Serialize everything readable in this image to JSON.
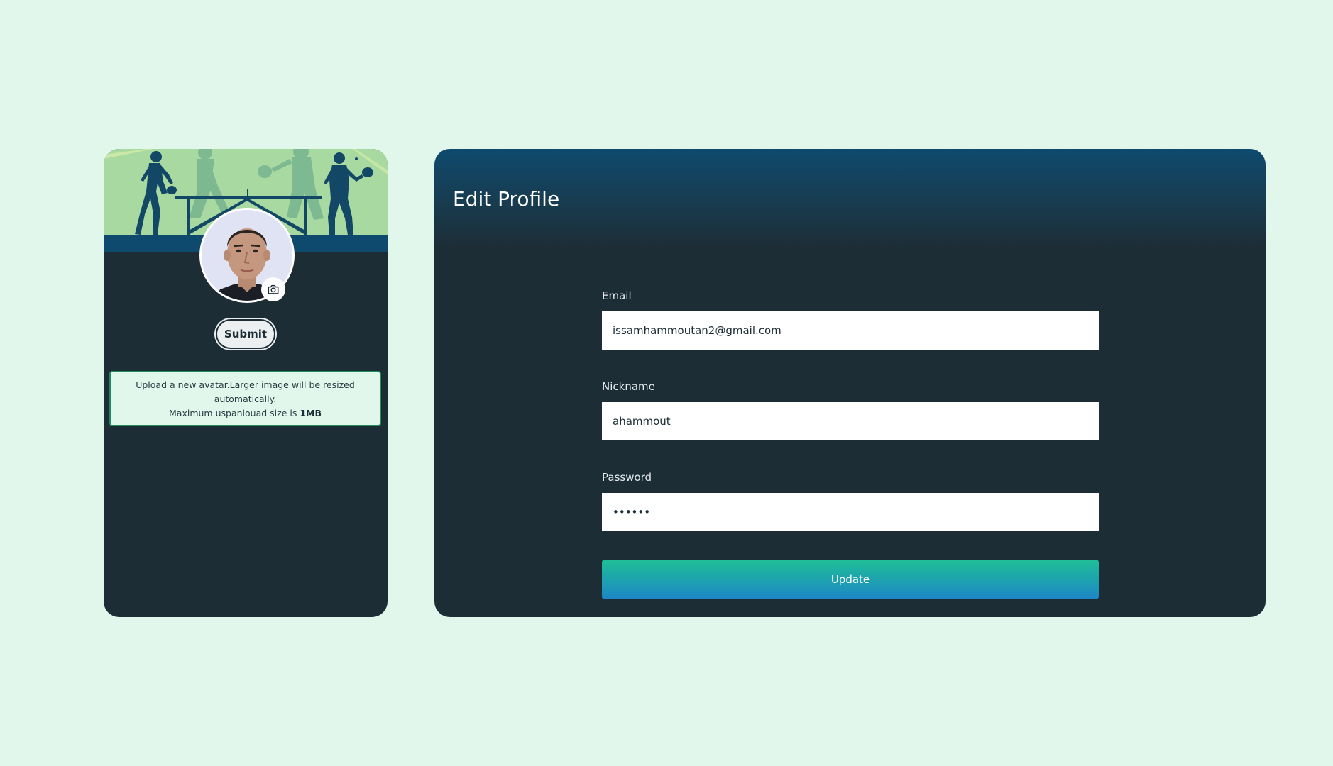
{
  "avatar_panel": {
    "submit_label": "Submit",
    "info_line_1": "Upload a new avatar.Larger image will be resized automatically.",
    "info_line_2_prefix": "Maximum uspanlouad size is ",
    "info_line_2_value": "1MB"
  },
  "edit_profile": {
    "title": "Edit Profile",
    "email": {
      "label": "Email",
      "value": "issamhammoutan2@gmail.com"
    },
    "nickname": {
      "label": "Nickname",
      "value": "ahammout"
    },
    "password": {
      "label": "Password",
      "value": "••••••"
    },
    "update_label": "Update"
  },
  "icons": {
    "avatar_upload": "camera-icon",
    "banner": "table-tennis-players-illustration"
  },
  "colors": {
    "page_background": "#e2f7ec",
    "card_background": "#1d2d36",
    "header_blue": "#0e4a6e",
    "banner_green": "#a7d9a0",
    "update_gradient_top": "#1fbf97",
    "update_gradient_bottom": "#1d86c6"
  }
}
